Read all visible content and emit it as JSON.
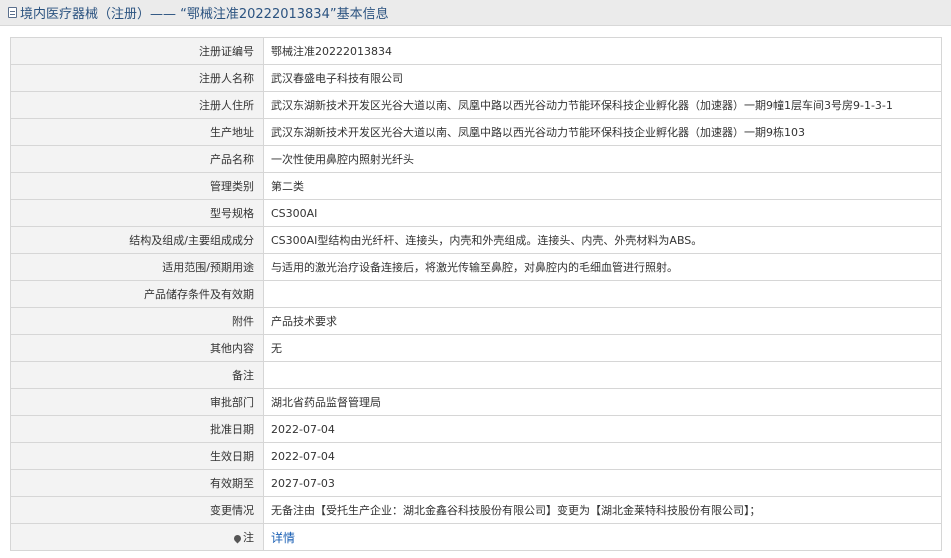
{
  "header": {
    "title": "境内医疗器械（注册）—— “鄂械注准20222013834”基本信息"
  },
  "rows": [
    {
      "label": "注册证编号",
      "value": "鄂械注准20222013834"
    },
    {
      "label": "注册人名称",
      "value": "武汉春盛电子科技有限公司"
    },
    {
      "label": "注册人住所",
      "value": "武汉东湖新技术开发区光谷大道以南、凤凰中路以西光谷动力节能环保科技企业孵化器（加速器）一期9幢1层车间3号房9-1-3-1"
    },
    {
      "label": "生产地址",
      "value": "武汉东湖新技术开发区光谷大道以南、凤凰中路以西光谷动力节能环保科技企业孵化器（加速器）一期9栋103"
    },
    {
      "label": "产品名称",
      "value": "一次性使用鼻腔内照射光纤头"
    },
    {
      "label": "管理类别",
      "value": "第二类"
    },
    {
      "label": "型号规格",
      "value": "CS300AI"
    },
    {
      "label": "结构及组成/主要组成成分",
      "value": "CS300AI型结构由光纤杆、连接头，内壳和外壳组成。连接头、内壳、外壳材料为ABS。"
    },
    {
      "label": "适用范围/预期用途",
      "value": "与适用的激光治疗设备连接后，将激光传输至鼻腔，对鼻腔内的毛细血管进行照射。"
    },
    {
      "label": "产品储存条件及有效期",
      "value": ""
    },
    {
      "label": "附件",
      "value": "产品技术要求"
    },
    {
      "label": "其他内容",
      "value": "无"
    },
    {
      "label": "备注",
      "value": ""
    },
    {
      "label": "审批部门",
      "value": "湖北省药品监督管理局"
    },
    {
      "label": "批准日期",
      "value": "2022-07-04"
    },
    {
      "label": "生效日期",
      "value": "2022-07-04"
    },
    {
      "label": "有效期至",
      "value": "2027-07-03"
    },
    {
      "label": "变更情况",
      "value": "无备注由【受托生产企业：湖北金鑫谷科技股份有限公司】变更为【湖北金莱特科技股份有限公司】；"
    }
  ],
  "note_row": {
    "label": "注",
    "link_text": "详情"
  }
}
